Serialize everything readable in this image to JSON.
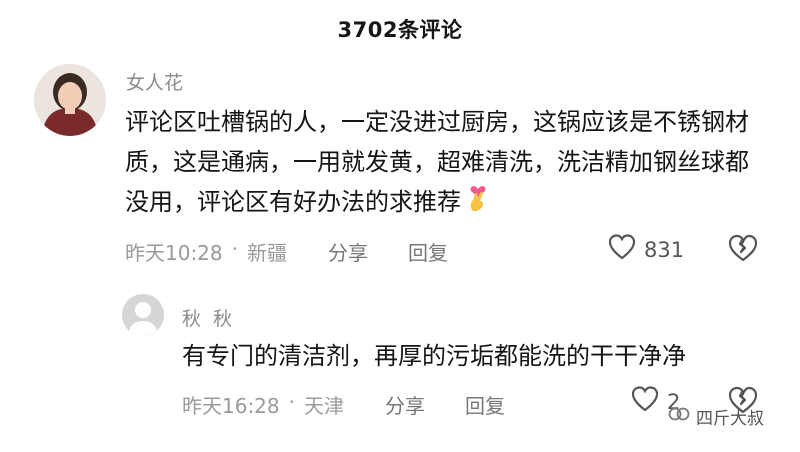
{
  "header": {
    "title": "3702条评论"
  },
  "comment": {
    "username": "女人花",
    "text": "评论区吐槽锅的人，一定没进过厨房，这锅应该是不锈钢材质，这是通病，一用就发黄，超难清洗，洗洁精加钢丝球都没用，评论区有好办法的求推荐",
    "emoji": "crossed-fingers-heart-emoji",
    "time": "昨天10:28",
    "separator": "·",
    "location": "新疆",
    "share_label": "分享",
    "reply_label": "回复",
    "likes": "831"
  },
  "reply": {
    "username": "秋 秋",
    "text": "有专门的清洁剂，再厚的污垢都能洗的干干净净",
    "time": "昨天16:28",
    "separator": "·",
    "location": "天津",
    "share_label": "分享",
    "reply_label": "回复",
    "likes": "2"
  },
  "watermark": {
    "text": "四斤大叔",
    "icon": "wechat-channel-icon"
  },
  "colors": {
    "text_primary": "#151515",
    "text_meta": "#9a9a9a",
    "heart_outline": "#555555"
  }
}
